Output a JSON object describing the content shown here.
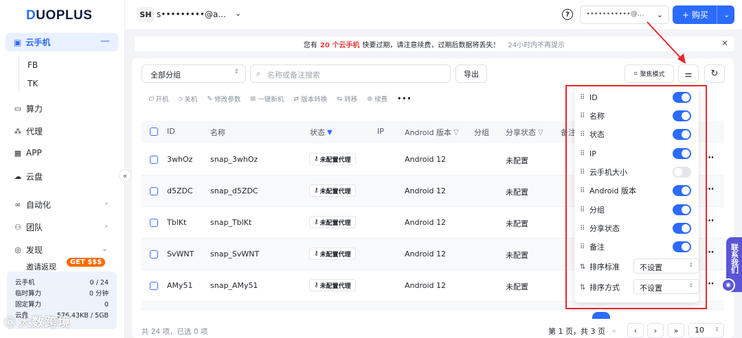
{
  "logo": {
    "d": "D",
    "rest": "UOPLUS"
  },
  "sidebar": {
    "active": "云手机",
    "sub": [
      "FB",
      "TK"
    ],
    "items": [
      {
        "label": "算力",
        "icon": "monitor-icon"
      },
      {
        "label": "代理",
        "icon": "network-icon"
      },
      {
        "label": "APP",
        "icon": "grid-icon"
      },
      {
        "label": "云盘",
        "icon": "cloud-icon"
      },
      {
        "label": "自动化",
        "icon": "infinity-icon"
      },
      {
        "label": "团队",
        "icon": "team-icon"
      },
      {
        "label": "发现",
        "icon": "compass-icon"
      }
    ],
    "partial_item": "邀请返现",
    "badge": "GET $$$",
    "stats": [
      {
        "label": "云手机",
        "value": "0 / 24"
      },
      {
        "label": "临时算力",
        "value": "0 分钟"
      },
      {
        "label": "固定算力",
        "value": "0"
      },
      {
        "label": "云盘",
        "value": "576.43KB / 5GB"
      }
    ]
  },
  "watermark": "大数跨境",
  "header": {
    "badge": "SH",
    "email": "s•••••••••@a...",
    "user_masked": "•••••••••••@...",
    "buy_label": "+ 购买"
  },
  "notice": {
    "prefix": "您有",
    "count": "20 个云手机",
    "text": "快要过期，请注意续费，过期后数据将丢失！",
    "dismiss": "24小时内不再提示"
  },
  "toolbar": {
    "group": "全部分组",
    "search_placeholder": "名称或备注搜索",
    "export": "导出",
    "mode": "聚焦模式"
  },
  "actions": [
    "开机",
    "关机",
    "修改参数",
    "一键新机",
    "版本转换",
    "转移",
    "续费"
  ],
  "table": {
    "headers": [
      "ID",
      "名称",
      "状态",
      "IP",
      "Android 版本",
      "分组",
      "分享状态",
      "备注"
    ],
    "rows": [
      {
        "id": "3whOz",
        "name": "snap_3whOz",
        "status": "未配置代理",
        "android": "Android 12",
        "share": "未配置"
      },
      {
        "id": "d5ZDC",
        "name": "snap_d5ZDC",
        "status": "未配置代理",
        "android": "Android 12",
        "share": "未配置"
      },
      {
        "id": "TblKt",
        "name": "snap_TblKt",
        "status": "未配置代理",
        "android": "Android 12",
        "share": "未配置"
      },
      {
        "id": "SvWNT",
        "name": "snap_SvWNT",
        "status": "未配置代理",
        "android": "Android 12",
        "share": "未配置"
      },
      {
        "id": "AMy51",
        "name": "snap_AMy51",
        "status": "未配置代理",
        "android": "Android 12",
        "share": "未配置"
      }
    ]
  },
  "footer": {
    "summary": "共 24 项，已选 0 项",
    "page_text": "第 1 页，共 3 页",
    "page_size": "10"
  },
  "column_panel": {
    "columns": [
      {
        "label": "ID",
        "on": true
      },
      {
        "label": "名称",
        "on": true
      },
      {
        "label": "状态",
        "on": true
      },
      {
        "label": "IP",
        "on": true
      },
      {
        "label": "云手机大小",
        "on": false
      },
      {
        "label": "Android 版本",
        "on": true
      },
      {
        "label": "分组",
        "on": true
      },
      {
        "label": "分享状态",
        "on": true
      },
      {
        "label": "备注",
        "on": true
      }
    ],
    "sort_field_label": "排序标准",
    "sort_field_value": "不设置",
    "sort_order_label": "排序方式",
    "sort_order_value": "不设置"
  },
  "contact": "联系我们",
  "colors": {
    "accent": "#2c6bff",
    "highlight_box": "#e8262a",
    "notice_red": "#e5393c"
  }
}
